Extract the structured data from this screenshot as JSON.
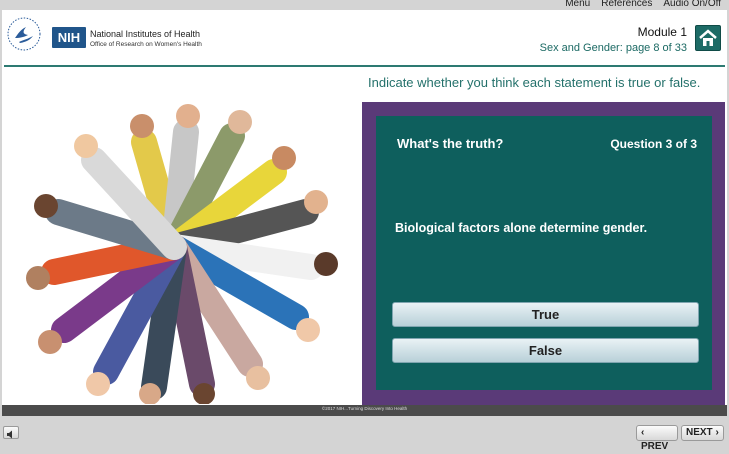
{
  "top_menu": {
    "menu_label": "Menu",
    "references_label": "References",
    "audio_label": "Audio On/Off"
  },
  "header": {
    "nih_badge": "NIH",
    "nih_line1": "National Institutes of Health",
    "nih_line2": "Office of Research on Women's Health",
    "module_title": "Module 1",
    "module_subtitle": "Sex and Gender: page 8 of 33",
    "home_icon": "home-icon"
  },
  "instruction": "Indicate whether you think each statement is true or false.",
  "question": {
    "heading": "What's the truth?",
    "counter": "Question 3 of 3",
    "statement": "Biological factors alone determine gender.",
    "answers": [
      "True",
      "False"
    ]
  },
  "footer": {
    "copyright": "©2017 NIH...Turning Discovery Into Health"
  },
  "nav": {
    "prev_label": "PREV",
    "next_label": "NEXT",
    "volume_icon": "speaker-icon"
  },
  "colors": {
    "teal": "#0e5f5d",
    "purple_frame": "#5a3a78",
    "accent_text": "#24716b"
  }
}
